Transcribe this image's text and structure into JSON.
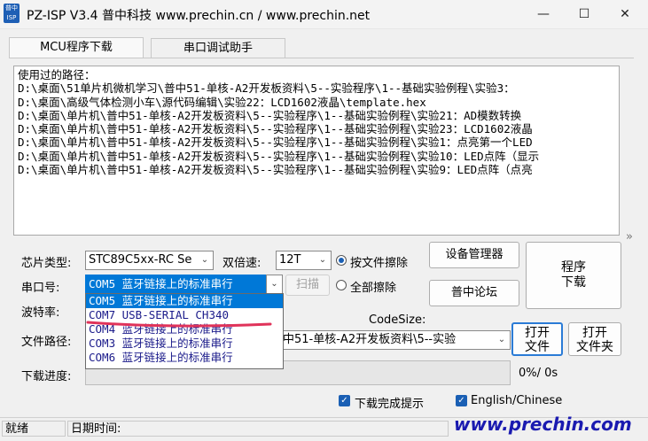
{
  "window": {
    "app_icon_text": "普中ISP",
    "title": "PZ-ISP V3.4 普中科技   www.prechin.cn / www.prechin.net",
    "minimize_glyph": "—",
    "maximize_glyph": "☐",
    "close_glyph": "✕"
  },
  "tabs": [
    {
      "label": "MCU程序下载"
    },
    {
      "label": "串口调试助手"
    }
  ],
  "log": {
    "lines": [
      "使用过的路径：",
      "D:\\桌面\\51单片机微机学习\\普中51-单核-A2开发板资料\\5--实验程序\\1--基础实验例程\\实验3：",
      "D:\\桌面\\高级气体检测小车\\源代码编辑\\实验22：LCD1602液晶\\template.hex",
      "D:\\桌面\\单片机\\普中51-单核-A2开发板资料\\5--实验程序\\1--基础实验例程\\实验21：AD模数转换",
      "D:\\桌面\\单片机\\普中51-单核-A2开发板资料\\5--实验程序\\1--基础实验例程\\实验23：LCD1602液晶",
      "D:\\桌面\\单片机\\普中51-单核-A2开发板资料\\5--实验程序\\1--基础实验例程\\实验1：点亮第一个LED",
      "D:\\桌面\\单片机\\普中51-单核-A2开发板资料\\5--实验程序\\1--基础实验例程\\实验10：LED点阵（显示",
      "D:\\桌面\\单片机\\普中51-单核-A2开发板资料\\5--实验程序\\1--基础实验例程\\实验9：LED点阵（点亮"
    ]
  },
  "side_arrows": "»",
  "chip": {
    "label": "芯片类型:",
    "value": "STC89C5xx-RC Se"
  },
  "speed": {
    "label": "双倍速:",
    "value": "12T"
  },
  "erase_file": {
    "label": "按文件擦除"
  },
  "erase_all": {
    "label": "全部擦除"
  },
  "device_manager_button": "设备管理器",
  "forum_button": "普中论坛",
  "program_button": {
    "line1": "程序",
    "line2": "下载"
  },
  "port": {
    "label": "串口号:",
    "value": "COM5  蓝牙链接上的标准串行"
  },
  "scan_button": "扫描",
  "baud": {
    "label": "波特率:"
  },
  "codesize": {
    "label": "CodeSize:"
  },
  "file": {
    "label": "文件路径:",
    "value": "中51-单核-A2开发板资料\\5--实验"
  },
  "open_file_button": {
    "line1": "打开",
    "line2": "文件"
  },
  "open_folder_button": {
    "line1": "打开",
    "line2": "文件夹"
  },
  "progress": {
    "label": "下载进度:",
    "text": "0%/ 0s",
    "fraction": 0
  },
  "dropdown_items": [
    {
      "text": "COM5  蓝牙链接上的标准串行",
      "selected": true
    },
    {
      "text": "COM7  USB-SERIAL CH340",
      "selected": false
    },
    {
      "text": "COM4  蓝牙链接上的标准串行",
      "selected": false
    },
    {
      "text": "COM3  蓝牙链接上的标准串行",
      "selected": false
    },
    {
      "text": "COM6  蓝牙链接上的标准串行",
      "selected": false
    }
  ],
  "download_done_prompt": {
    "label": "下载完成提示",
    "checked": true
  },
  "language": {
    "label": "English/Chinese",
    "checked": true
  },
  "status": {
    "ready": "就绪",
    "date_label": "日期时间:"
  },
  "watermark": "www.prechin.com",
  "colors": {
    "accent": "#0078d7",
    "annotation": "#e0335a",
    "watermark": "#1a1ab0"
  }
}
